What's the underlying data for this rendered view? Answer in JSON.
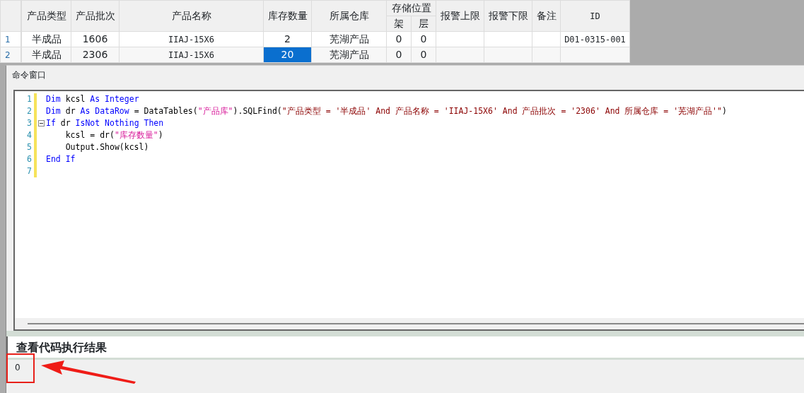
{
  "table": {
    "columns": [
      {
        "label": "产品类型"
      },
      {
        "label": "产品批次"
      },
      {
        "label": "产品名称"
      },
      {
        "label": "库存数量"
      },
      {
        "label": "所属仓库"
      },
      {
        "label": "存储位置",
        "colspan": 2,
        "children": [
          {
            "label": "架"
          },
          {
            "label": "层"
          }
        ]
      },
      {
        "label": "报警上限"
      },
      {
        "label": "报警下限"
      },
      {
        "label": "备注"
      },
      {
        "label": "ID"
      }
    ],
    "rows": [
      {
        "number": "1",
        "cells": [
          {
            "text": "半成品",
            "selected": false
          },
          {
            "text": "1606",
            "selected": false
          },
          {
            "text": "IIAJ-15X6",
            "selected": false
          },
          {
            "text": "2",
            "selected": false
          },
          {
            "text": "芜湖产品",
            "selected": false
          },
          {
            "text": "0",
            "selected": false
          },
          {
            "text": "0",
            "selected": false
          },
          {
            "selected": false
          },
          {
            "selected": false
          },
          {
            "selected": false
          },
          {
            "text": "D01-0315-001",
            "selected": false
          }
        ]
      },
      {
        "number": "2",
        "cells": [
          {
            "text": "半成品",
            "selected": false
          },
          {
            "text": "2306",
            "selected": false
          },
          {
            "text": "IIAJ-15X6",
            "selected": false
          },
          {
            "text": "20",
            "selected": true
          },
          {
            "text": "芜湖产品",
            "selected": false
          },
          {
            "text": "0",
            "selected": false
          },
          {
            "text": "0",
            "selected": false
          },
          {
            "selected": false
          },
          {
            "selected": false
          },
          {
            "selected": false
          },
          {
            "selected": false
          }
        ]
      }
    ]
  },
  "command_window": {
    "title": "命令窗口",
    "code_lines": [
      {
        "number": "1",
        "folded_marker": false,
        "tokens": [
          {
            "kind": "keyword",
            "text": "Dim"
          },
          {
            "kind": "plain",
            "text": " kcsl "
          },
          {
            "kind": "keyword",
            "text": "As Integer"
          }
        ]
      },
      {
        "number": "2",
        "folded_marker": false,
        "tokens": [
          {
            "kind": "keyword",
            "text": "Dim"
          },
          {
            "kind": "plain",
            "text": " dr "
          },
          {
            "kind": "keyword",
            "text": "As DataRow"
          },
          {
            "kind": "plain",
            "text": " = DataTables("
          },
          {
            "kind": "string",
            "text": "\"产品库\""
          },
          {
            "kind": "plain",
            "text": ").SQLFind("
          },
          {
            "kind": "sql",
            "text": "\"产品类型 = '半成品' And 产品名称 = 'IIAJ-15X6' And 产品批次 = '2306' And 所属仓库 = '芜湖产品'\""
          },
          {
            "kind": "plain",
            "text": ")"
          }
        ]
      },
      {
        "number": "3",
        "folded_marker": true,
        "tokens": [
          {
            "kind": "keyword",
            "text": "If"
          },
          {
            "kind": "plain",
            "text": " dr "
          },
          {
            "kind": "keyword",
            "text": "IsNot Nothing Then"
          }
        ]
      },
      {
        "number": "4",
        "folded_marker": false,
        "tokens": [
          {
            "kind": "plain",
            "text": "    kcsl = dr("
          },
          {
            "kind": "string",
            "text": "\"库存数量\""
          },
          {
            "kind": "plain",
            "text": ")"
          }
        ]
      },
      {
        "number": "5",
        "folded_marker": false,
        "tokens": [
          {
            "kind": "plain",
            "text": "    Output.Show(kcsl)"
          }
        ]
      },
      {
        "number": "6",
        "folded_marker": false,
        "tokens": [
          {
            "kind": "keyword",
            "text": "End If"
          }
        ]
      },
      {
        "number": "7",
        "folded_marker": false
      }
    ],
    "result_heading": "查看代码执行结果",
    "output": "0"
  }
}
